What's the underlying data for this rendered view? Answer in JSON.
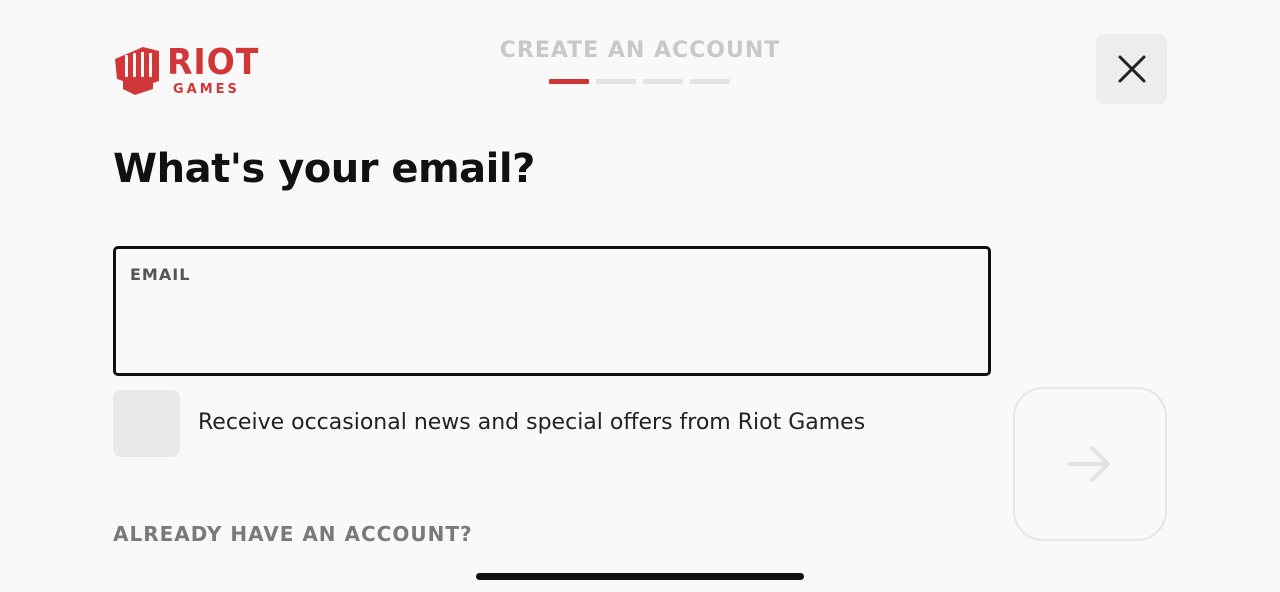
{
  "brand": {
    "logo_line1": "RIOT",
    "logo_line2": "GAMES",
    "brand_color": "#d13639"
  },
  "header": {
    "step_title": "CREATE AN ACCOUNT",
    "progress": {
      "current_step": 1,
      "total_steps": 4
    },
    "close_icon": "close-icon"
  },
  "form": {
    "heading": "What's your email?",
    "email": {
      "label": "EMAIL",
      "value": "",
      "placeholder": ""
    },
    "newsletter": {
      "label": "Receive occasional news and special offers from Riot Games",
      "checked": false
    },
    "next_icon": "arrow-right-icon",
    "signin_link": "ALREADY HAVE AN ACCOUNT?"
  }
}
